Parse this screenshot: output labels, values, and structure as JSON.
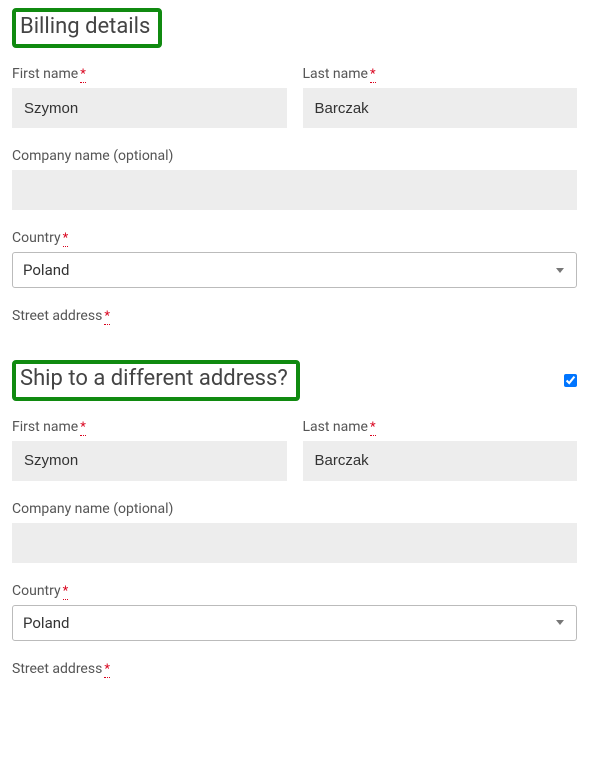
{
  "required_mark": "*",
  "billing": {
    "heading": "Billing details",
    "first_name_label": "First name",
    "first_name_value": "Szymon",
    "last_name_label": "Last name",
    "last_name_value": "Barczak",
    "company_label": "Company name (optional)",
    "company_value": "",
    "country_label": "Country",
    "country_value": "Poland",
    "street_label": "Street address"
  },
  "shipping": {
    "heading": "Ship to a different address?",
    "checkbox_checked": true,
    "first_name_label": "First name",
    "first_name_value": "Szymon",
    "last_name_label": "Last name",
    "last_name_value": "Barczak",
    "company_label": "Company name (optional)",
    "company_value": "",
    "country_label": "Country",
    "country_value": "Poland",
    "street_label": "Street address"
  }
}
